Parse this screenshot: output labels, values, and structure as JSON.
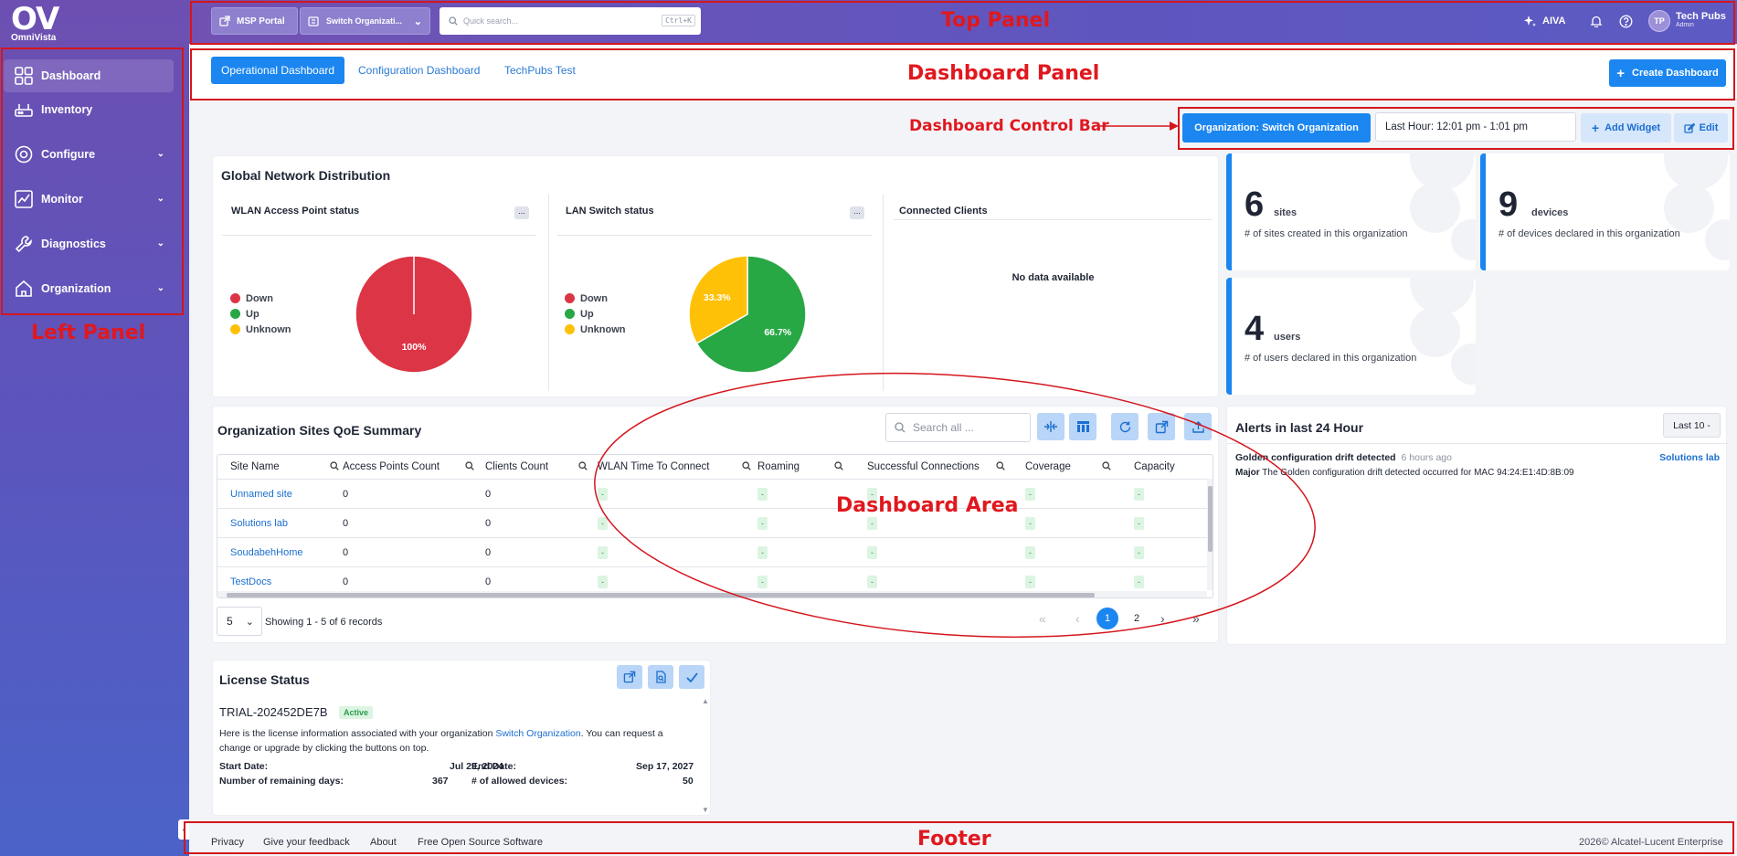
{
  "app": {
    "logo": "OV",
    "name": "OmniVista"
  },
  "sidebar": {
    "items": [
      {
        "label": "Dashboard",
        "icon": "dashboard-grid-icon"
      },
      {
        "label": "Inventory",
        "icon": "router-icon"
      },
      {
        "label": "Configure",
        "icon": "configure-icon"
      },
      {
        "label": "Monitor",
        "icon": "monitor-chart-icon"
      },
      {
        "label": "Diagnostics",
        "icon": "wrench-icon"
      },
      {
        "label": "Organization",
        "icon": "home-icon"
      }
    ]
  },
  "topbar": {
    "msp_portal": "MSP Portal",
    "org_select": "Switch Organizati...",
    "search_placeholder": "Quick search...",
    "search_shortcut": "Ctrl+K",
    "aiva": "AIVA",
    "user_initials": "TP",
    "user_name": "Tech Pubs",
    "user_role": "Admin"
  },
  "dashboard_tabs": [
    "Operational Dashboard",
    "Configuration Dashboard",
    "TechPubs Test"
  ],
  "create_dashboard": "Create Dashboard",
  "control_bar": {
    "org_button": "Organization: Switch Organization",
    "time_range": "Last Hour: 12:01 pm - 1:01 pm",
    "add_widget": "Add Widget",
    "edit": "Edit"
  },
  "global_network": {
    "title": "Global Network Distribution",
    "wlan_title": "WLAN Access Point status",
    "lan_title": "LAN Switch status",
    "clients_title": "Connected Clients",
    "no_data": "No data available",
    "legend": [
      "Down",
      "Up",
      "Unknown"
    ],
    "colors": {
      "down": "#dc3545",
      "up": "#28a745",
      "unknown": "#ffc107"
    }
  },
  "chart_data": [
    {
      "type": "pie",
      "title": "WLAN Access Point status",
      "labels": [
        "Down"
      ],
      "values": [
        100
      ],
      "value_labels": [
        "100%"
      ]
    },
    {
      "type": "pie",
      "title": "LAN Switch status",
      "labels": [
        "Up",
        "Unknown"
      ],
      "values": [
        66.7,
        33.3
      ],
      "value_labels": [
        "66.7%",
        "33.3%"
      ]
    }
  ],
  "stats": [
    {
      "number": "6",
      "unit": "sites",
      "desc": "# of sites created in this organization"
    },
    {
      "number": "9",
      "unit": "devices",
      "desc": "# of devices declared in this organization"
    },
    {
      "number": "4",
      "unit": "users",
      "desc": "# of users declared in this organization"
    }
  ],
  "qoe": {
    "title": "Organization Sites QoE Summary",
    "search_placeholder": "Search all ...",
    "columns": [
      "Site Name",
      "Access Points Count",
      "Clients Count",
      "WLAN Time To Connect",
      "Roaming",
      "Successful Connections",
      "Coverage",
      "Capacity"
    ],
    "rows": [
      [
        "Unnamed site",
        "0",
        "0",
        "-",
        "-",
        "-",
        "-",
        "-"
      ],
      [
        "Solutions lab",
        "0",
        "0",
        "-",
        "-",
        "-",
        "-",
        "-"
      ],
      [
        "SoudabehHome",
        "0",
        "0",
        "-",
        "-",
        "-",
        "-",
        "-"
      ],
      [
        "TestDocs",
        "0",
        "0",
        "-",
        "-",
        "-",
        "-",
        "-"
      ]
    ],
    "page_size": "5",
    "showing": "Showing 1 - 5 of 6 records",
    "pages": [
      "1",
      "2"
    ]
  },
  "alerts": {
    "title": "Alerts in last 24 Hour",
    "filter": "Last 10 -",
    "items": [
      {
        "title": "Golden configuration drift detected",
        "time": "6 hours ago",
        "site": "Solutions lab",
        "severity": "Major",
        "message": "The Golden configuration drift detected occurred for MAC 94:24:E1:4D:8B:09"
      }
    ]
  },
  "license": {
    "title": "License Status",
    "name": "TRIAL-202452DE7B",
    "status": "Active",
    "desc_pre": "Here is the license information associated with your organization",
    "org_link": "Switch Organization",
    "desc_post": ". You can request a change or upgrade by clicking the buttons on top.",
    "start_label": "Start Date:",
    "start_value": "Jul 29, 2024",
    "end_label": "End Date:",
    "end_value": "Sep 17, 2027",
    "remaining_label": "Number of remaining days:",
    "remaining_value": "367",
    "allowed_label": "# of allowed devices:",
    "allowed_value": "50"
  },
  "footer": {
    "links": [
      "Privacy",
      "Give your feedback",
      "About",
      "Free Open Source Software"
    ],
    "copyright": "2026© Alcatel-Lucent Enterprise"
  },
  "annotations": {
    "top_panel": "Top Panel",
    "dashboard_panel": "Dashboard Panel",
    "control_bar": "Dashboard Control Bar",
    "left_panel": "Left Panel",
    "dashboard_area": "Dashboard Area",
    "footer": "Footer"
  }
}
